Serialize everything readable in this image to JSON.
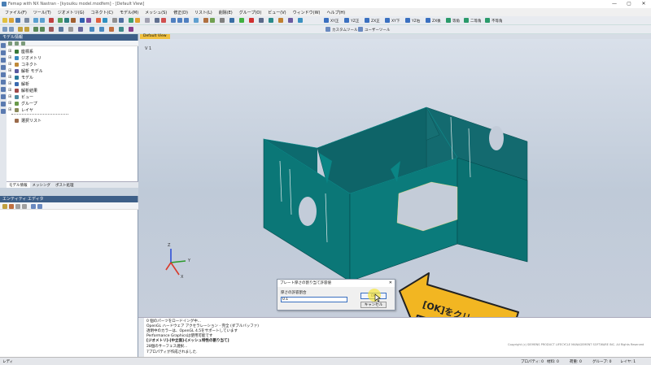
{
  "window": {
    "title": "Femap with NX Nastran - [kyouiku model.modfem] - [Default View]",
    "controls": [
      "—",
      "▢",
      "✕"
    ]
  },
  "menu": [
    "ファイル(F)",
    "ツール(T)",
    "ジオメトリ(G)",
    "コネクト(C)",
    "モデル(M)",
    "メッシュ(S)",
    "修正(D)",
    "リスト(L)",
    "削除(E)",
    "グループ(O)",
    "ビュー(V)",
    "ウィンドウ(W)",
    "ヘルプ(H)"
  ],
  "toolbar": {
    "view_buttons": [
      "XY正",
      "YZ正",
      "ZX正",
      "XY下",
      "YZ右",
      "ZX後"
    ],
    "iso_label": "等角",
    "dimetric_label": "二等角",
    "trimetric_label": "不等角",
    "custom_tools": "カスタムツール",
    "user_tools": "ユーザーツール"
  },
  "view_tab": "Default View",
  "model_info": {
    "header": "モデル情報",
    "items": [
      "座標系",
      "ジオメトリ",
      "コネクト",
      "解析 モデル",
      "モデル",
      "解析",
      "解析結果",
      "ビュー",
      "グループ",
      "レイヤ"
    ],
    "selection_list": "選択リスト",
    "tabs": [
      "モデル情報",
      "メッシング",
      "ポスト処理"
    ]
  },
  "entity_editor": {
    "header": "エンティティ エディタ"
  },
  "viewport": {
    "view_label": "V 1",
    "axes": {
      "x": "X",
      "y": "Y",
      "z": "Z"
    }
  },
  "dialog": {
    "title": "プレート厚さの割り当て許容値",
    "field_label": "厚さの許容割合",
    "value": "0.1",
    "ok": "OK",
    "cancel": "キャンセル"
  },
  "callout": {
    "text": "[OK]をクリック"
  },
  "console": {
    "lines": [
      "0 個のパーツをロードイング中...",
      "OpenGL ハードウェア アクセラレーション - 完全 (ダブルバッファ)",
      "透明中のカラーは、OpenGL 4.5をサポートしています",
      "Performance Graphicsは使用可能です",
      "[ジオメトリ]-[中立面]-[メッシュ特性の割り当て]",
      "28個のサーフェス選択...",
      "7プロパティが作成されました."
    ],
    "copyright": "Copyright (c) SIEMENS PRODUCT LIFECYCLE MANAGEMENT SOFTWARE INC. All Rights Reserved"
  },
  "status": {
    "left": "レディ",
    "prop": "プロパティ: 0",
    "material": "材料: 0",
    "load": "荷重: 0",
    "group": "グループ: 0",
    "layer": "レイヤ: 1"
  },
  "colors": {
    "model": "#0b7777",
    "panel_header": "#3d5f88",
    "callout_arrow": "#f2b622",
    "callout_border": "#222222"
  }
}
